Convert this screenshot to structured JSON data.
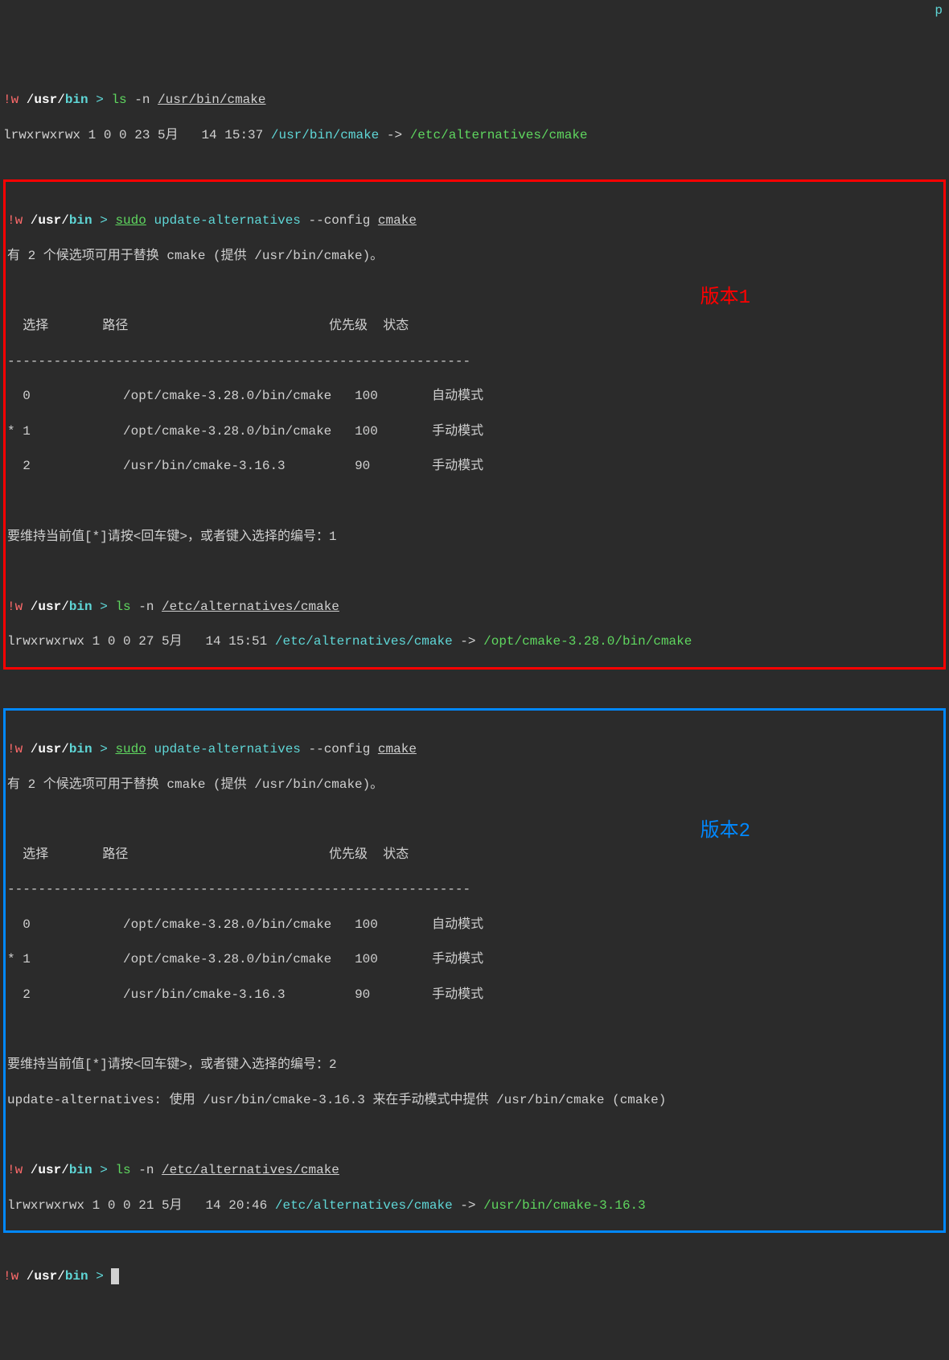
{
  "prompt": {
    "bang_w": "!w",
    "slash1": " /",
    "usr": "usr",
    "slash2": "/",
    "bin": "bin",
    "gt": " > "
  },
  "top": {
    "cmd": "ls",
    "flags": " -n ",
    "arg": "/usr/bin/cmake",
    "out_prefix": "lrwxrwxrwx 1 0 0 23 5月   14 15:37 ",
    "out_path": "/usr/bin/cmake",
    "arrow": " -> ",
    "out_target": "/etc/alternatives/cmake",
    "top_p": "p"
  },
  "box1": {
    "annotation": "版本1",
    "sudo": "sudo",
    "ua": " update-alternatives",
    "flags": " --config ",
    "arg": "cmake",
    "desc": "有 2 个候选项可用于替换 cmake (提供 /usr/bin/cmake)。",
    "header": "  选择       路径                          优先级  状态",
    "divider": "------------------------------------------------------------",
    "r0": "  0            /opt/cmake-3.28.0/bin/cmake   100       自动模式",
    "r1": "* 1            /opt/cmake-3.28.0/bin/cmake   100       手动模式",
    "r2": "  2            /usr/bin/cmake-3.16.3         90        手动模式",
    "prompt_input": "要维持当前值[*]请按<回车键>，或者键入选择的编号：1",
    "ls_cmd": "ls",
    "ls_flags": " -n ",
    "ls_arg": "/etc/alternatives/cmake",
    "out_prefix": "lrwxrwxrwx 1 0 0 27 5月   14 15:51 ",
    "out_path": "/etc/alternatives/cmake",
    "arrow": " -> ",
    "out_target": "/opt/cmake-3.28.0/bin/cmake"
  },
  "box2": {
    "annotation": "版本2",
    "sudo": "sudo",
    "ua": " update-alternatives",
    "flags": " --config ",
    "arg": "cmake",
    "desc": "有 2 个候选项可用于替换 cmake (提供 /usr/bin/cmake)。",
    "header": "  选择       路径                          优先级  状态",
    "divider": "------------------------------------------------------------",
    "r0": "  0            /opt/cmake-3.28.0/bin/cmake   100       自动模式",
    "r1": "* 1            /opt/cmake-3.28.0/bin/cmake   100       手动模式",
    "r2": "  2            /usr/bin/cmake-3.16.3         90        手动模式",
    "prompt_input": "要维持当前值[*]请按<回车键>，或者键入选择的编号：2",
    "update_msg": "update-alternatives: 使用 /usr/bin/cmake-3.16.3 来在手动模式中提供 /usr/bin/cmake (cmake)",
    "ls_cmd": "ls",
    "ls_flags": " -n ",
    "ls_arg": "/etc/alternatives/cmake",
    "out_prefix": "lrwxrwxrwx 1 0 0 21 5月   14 20:46 ",
    "out_path": "/etc/alternatives/cmake",
    "arrow": " -> ",
    "out_target": "/usr/bin/cmake-3.16.3"
  }
}
